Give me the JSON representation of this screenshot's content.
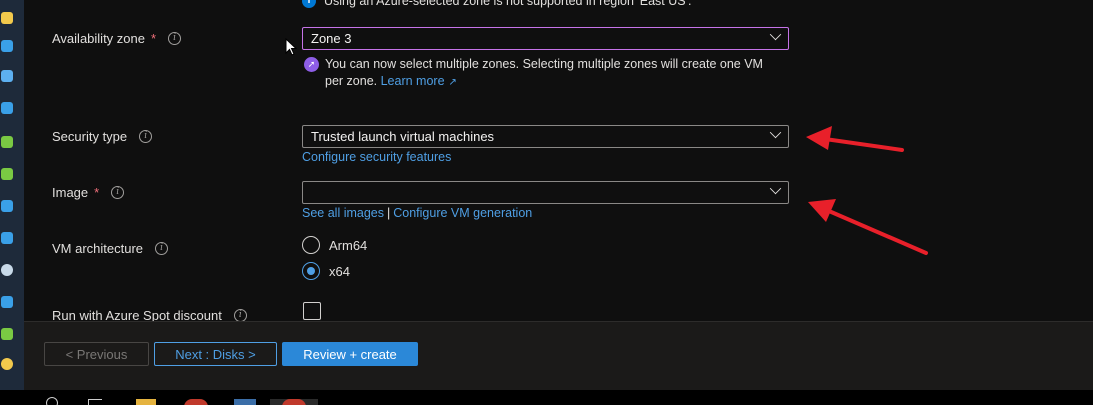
{
  "notice_top": {
    "icon": "info-icon",
    "text": "Using an Azure-selected zone is not supported in region 'East US'."
  },
  "availability_zone": {
    "label": "Availability zone",
    "required": "*",
    "value": "Zone 3",
    "message": "You can now select multiple zones. Selecting multiple zones will create one VM per zone.",
    "learn_more": "Learn more"
  },
  "security_type": {
    "label": "Security type",
    "value": "Trusted launch virtual machines",
    "link": "Configure security features"
  },
  "image": {
    "label": "Image",
    "required": "*",
    "value": "",
    "link_all": "See all images",
    "separator": "|",
    "link_gen": "Configure VM generation"
  },
  "vm_architecture": {
    "label": "VM architecture",
    "options": [
      "Arm64",
      "x64"
    ],
    "selected": "x64"
  },
  "spot": {
    "label": "Run with Azure Spot discount",
    "checked": false
  },
  "footer": {
    "previous": "< Previous",
    "next": "Next : Disks >",
    "create": "Review + create"
  },
  "colors": {
    "accent": "#2b88d8",
    "link": "#4f9fe4",
    "focus": "#c573e8",
    "annotation": "#e8202a"
  }
}
